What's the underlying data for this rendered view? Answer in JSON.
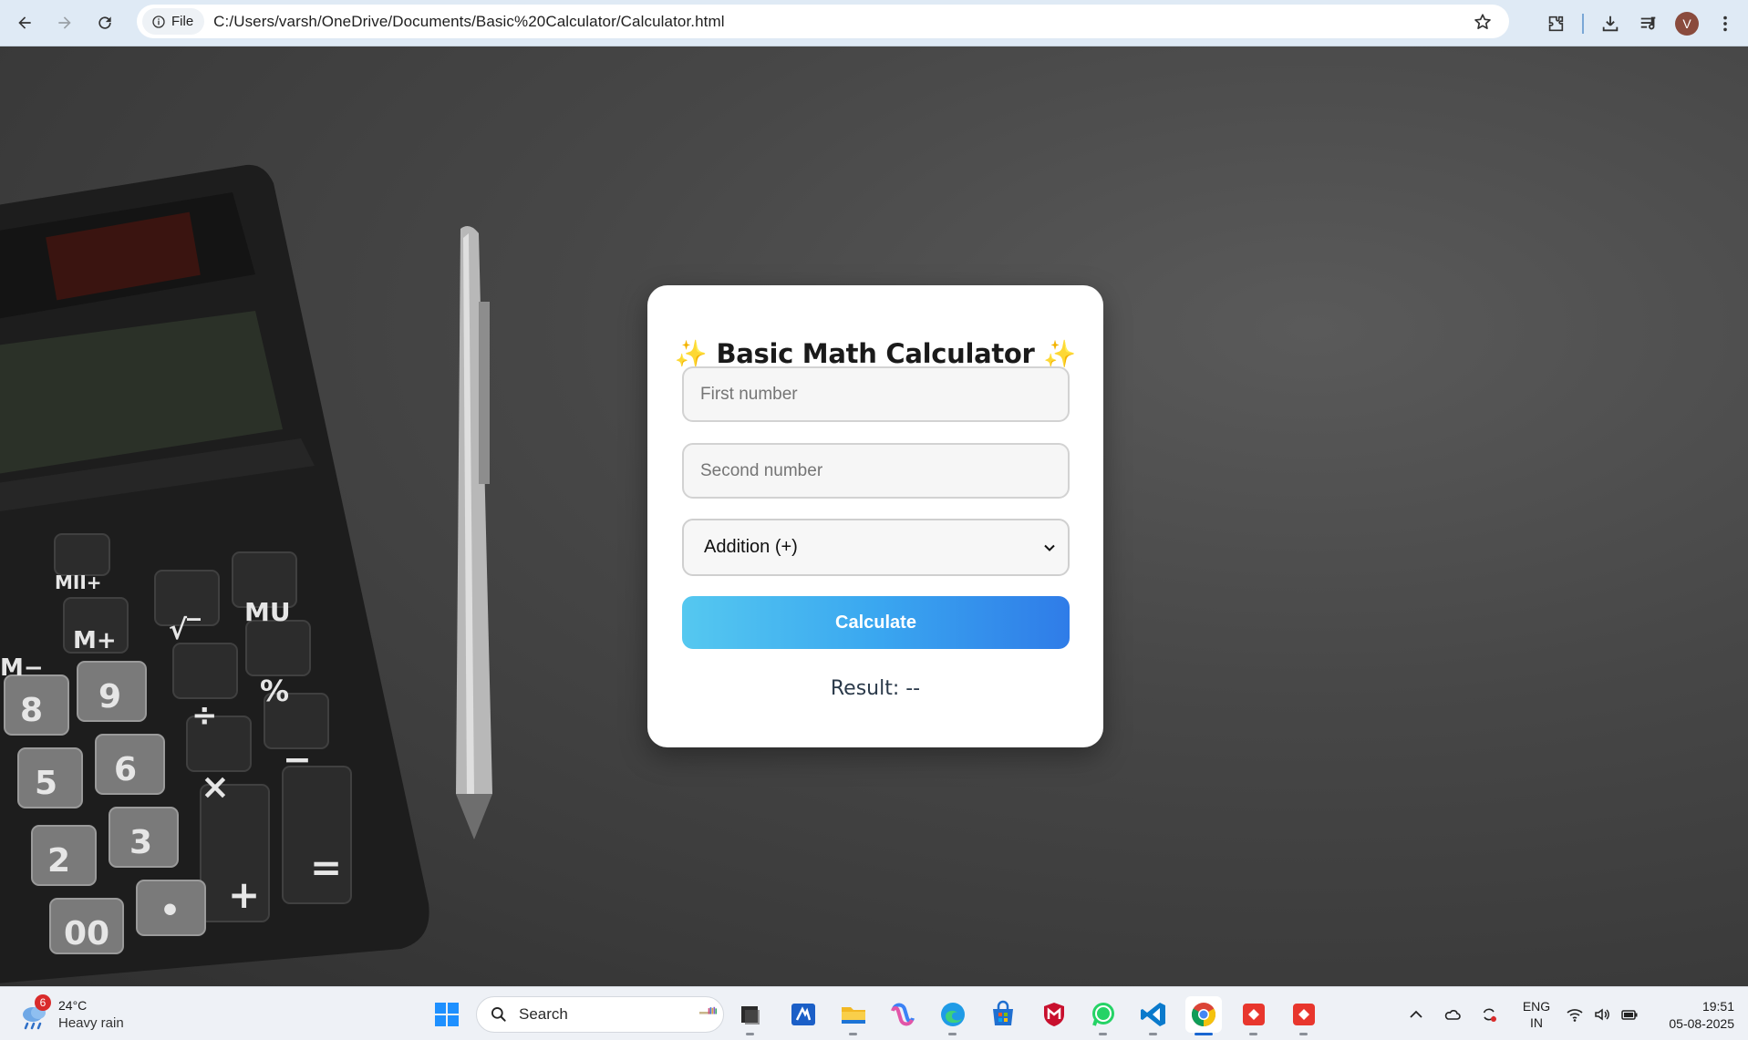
{
  "browser": {
    "file_chip_label": "File",
    "url": "C:/Users/varsh/OneDrive/Documents/Basic%20Calculator/Calculator.html",
    "profile_initial": "V"
  },
  "card": {
    "sparkle_left": "✨",
    "title": "Basic Math Calculator",
    "sparkle_right": "✨",
    "first_placeholder": "First number",
    "second_placeholder": "Second number",
    "operation_selected": "Addition (+)",
    "calculate_label": "Calculate",
    "result_text": "Result: --"
  },
  "taskbar": {
    "weather_badge": "6",
    "weather_temp": "24°C",
    "weather_desc": "Heavy rain",
    "search_label": "Search",
    "lang_line1": "ENG",
    "lang_line2": "IN",
    "time": "19:51",
    "date": "05-08-2025",
    "apps": [
      "windows-start",
      "task-view",
      "app-a",
      "file-explorer",
      "copilot",
      "edge",
      "store",
      "mcafee",
      "whatsapp",
      "vscode",
      "chrome",
      "app-red-1",
      "app-red-2"
    ]
  },
  "colors": {
    "chrome_bg": "#dfeaf5",
    "button_gradient_start": "#55c8f0",
    "button_gradient_end": "#2f7ce8",
    "sparkle": "#f5b400",
    "taskbar_bg": "#eef1f6"
  }
}
